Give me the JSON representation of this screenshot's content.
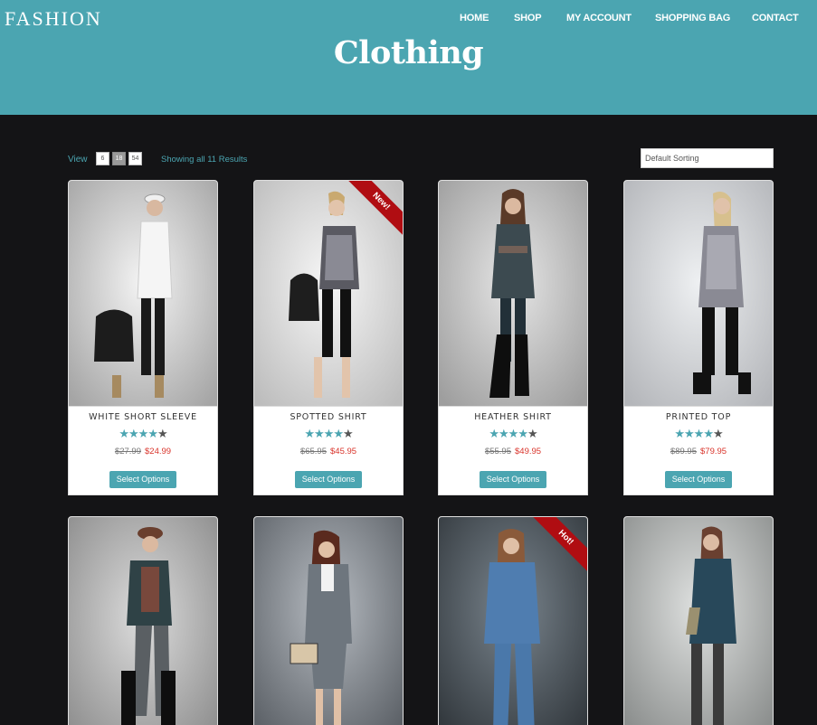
{
  "site": {
    "logo": "FASHION"
  },
  "nav": [
    {
      "label": "HOME"
    },
    {
      "label": "SHOP"
    },
    {
      "label": "MY ACCOUNT"
    },
    {
      "label": "SHOPPING BAG"
    },
    {
      "label": "CONTACT"
    }
  ],
  "page": {
    "title": "Clothing"
  },
  "toolbar": {
    "view_label": "View",
    "view_options": [
      "6",
      "18",
      "54"
    ],
    "active_view": "18",
    "results_text": "Showing all 11 Results",
    "sort_selected": "Default Sorting"
  },
  "products": [
    {
      "name": "WHITE SHORT SLEEVE",
      "rating": 4,
      "old_price": "$27.99",
      "price": "$24.99",
      "button": "Select Options",
      "badge": ""
    },
    {
      "name": "SPOTTED SHIRT",
      "rating": 4,
      "old_price": "$65.95",
      "price": "$45.95",
      "button": "Select Options",
      "badge": "New!"
    },
    {
      "name": "HEATHER SHIRT",
      "rating": 4,
      "old_price": "$55.95",
      "price": "$49.95",
      "button": "Select Options",
      "badge": ""
    },
    {
      "name": "PRINTED TOP",
      "rating": 4,
      "old_price": "$89.95",
      "price": "$79.95",
      "button": "Select Options",
      "badge": ""
    },
    {
      "name": "",
      "rating": 0,
      "old_price": "",
      "price": "",
      "button": "",
      "badge": ""
    },
    {
      "name": "",
      "rating": 0,
      "old_price": "",
      "price": "",
      "button": "",
      "badge": ""
    },
    {
      "name": "",
      "rating": 0,
      "old_price": "",
      "price": "",
      "button": "",
      "badge": "Hot!"
    },
    {
      "name": "",
      "rating": 0,
      "old_price": "",
      "price": "",
      "button": "",
      "badge": ""
    }
  ],
  "colors": {
    "accent": "#4ba5b1",
    "background": "#141416",
    "sale": "#d9342b",
    "ribbon": "#b00d12"
  }
}
